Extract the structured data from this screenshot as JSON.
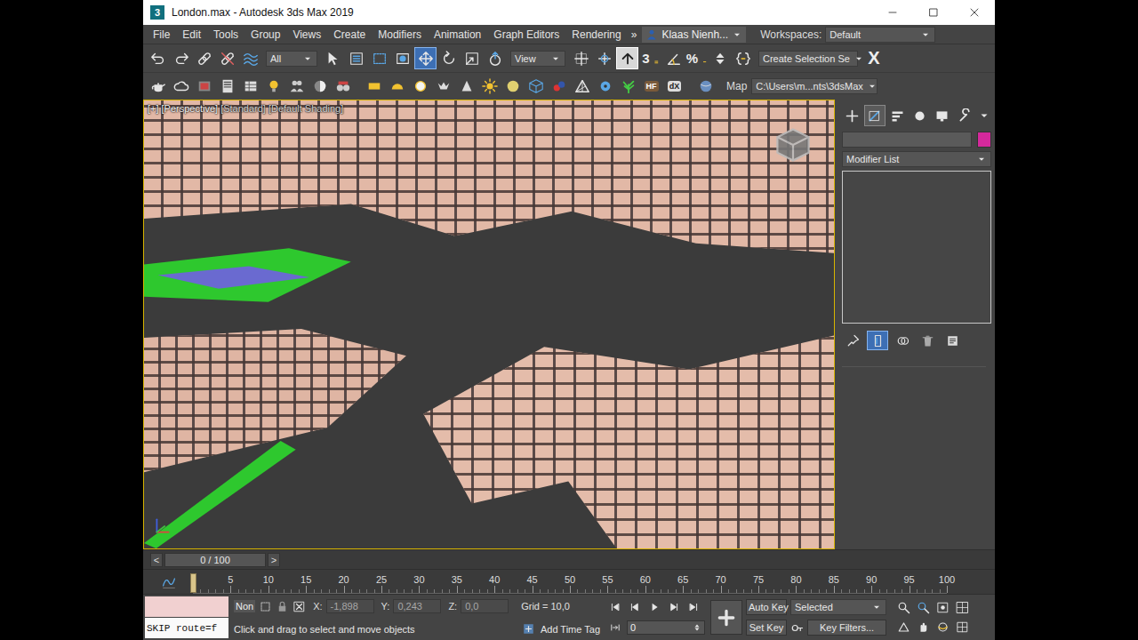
{
  "window": {
    "title": "London.max - Autodesk 3ds Max 2019",
    "app_icon": "3"
  },
  "menu": {
    "items": [
      "File",
      "Edit",
      "Tools",
      "Group",
      "Views",
      "Create",
      "Modifiers",
      "Animation",
      "Graph Editors",
      "Rendering"
    ],
    "overflow": "»",
    "user": "Klaas Nienh...",
    "workspaces_label": "Workspaces:",
    "workspace": "Default"
  },
  "main_toolbar": {
    "selection_filter": "All",
    "coordinate_system": "View",
    "named_selection": "Create Selection Se",
    "close_label": "X",
    "snap_label": "3",
    "percent_label": "%",
    "buttons": [
      {
        "selected": false
      },
      {
        "selected": false
      },
      {
        "selected": false
      },
      {
        "selected": false
      },
      {
        "selected": false
      },
      {
        "selected": false
      },
      {
        "selected": false
      },
      {
        "selected": false
      },
      {
        "selected": false
      },
      {
        "selected": true
      },
      {
        "selected": false
      },
      {
        "selected": false
      },
      {
        "selected": false
      },
      {
        "selected": false
      },
      {
        "selected": false
      },
      {
        "selected": true
      },
      {
        "selected": false
      },
      {
        "selected": false
      },
      {
        "selected": false
      },
      {
        "selected": false
      },
      {
        "selected": false
      }
    ]
  },
  "secondary_toolbar": {
    "hf_label": "HF",
    "dx_label": "dX",
    "map_label": "Map",
    "path": "C:\\Users\\m...nts\\3dsMax"
  },
  "viewport": {
    "labels": [
      "[+]",
      "[Perspective]",
      "[Standard]",
      "[Default Shading]"
    ],
    "active": true
  },
  "command_panel": {
    "tabs": [
      {
        "selected": false
      },
      {
        "selected": true
      },
      {
        "selected": false
      },
      {
        "selected": false
      },
      {
        "selected": false
      },
      {
        "selected": false
      }
    ],
    "object_name": "",
    "object_color": "#d4299c",
    "modifier_list": "Modifier List",
    "stack_tools": [
      {
        "selected": false
      },
      {
        "selected": true
      },
      {
        "selected": false
      },
      {
        "selected": false
      },
      {
        "selected": false
      }
    ]
  },
  "time_slider": {
    "prev": "<",
    "value": "0 / 100",
    "next": ">",
    "level": 0
  },
  "track_bar": {
    "ticks": [
      "5",
      "10",
      "15",
      "20",
      "25",
      "30",
      "35",
      "40",
      "45",
      "50",
      "55",
      "60",
      "65",
      "70",
      "75",
      "80",
      "85",
      "90",
      "95",
      "100"
    ],
    "current_frame_level": 0
  },
  "status_bar": {
    "listener_input": "",
    "listener_output": "SKIP route=f",
    "selection": "Non",
    "x_label": "X:",
    "x": "-1,898",
    "y_label": "Y:",
    "y": "0,243",
    "z_label": "Z:",
    "z": "0,0",
    "grid": "Grid = 10,0",
    "prompt": "Click and drag to select and move objects",
    "add_time_tag": "Add Time Tag"
  },
  "playback": {
    "frame": "0",
    "auto_key": "Auto Key",
    "set_key": "Set Key",
    "key_set": "Selected",
    "key_filters": "Key Filters..."
  }
}
